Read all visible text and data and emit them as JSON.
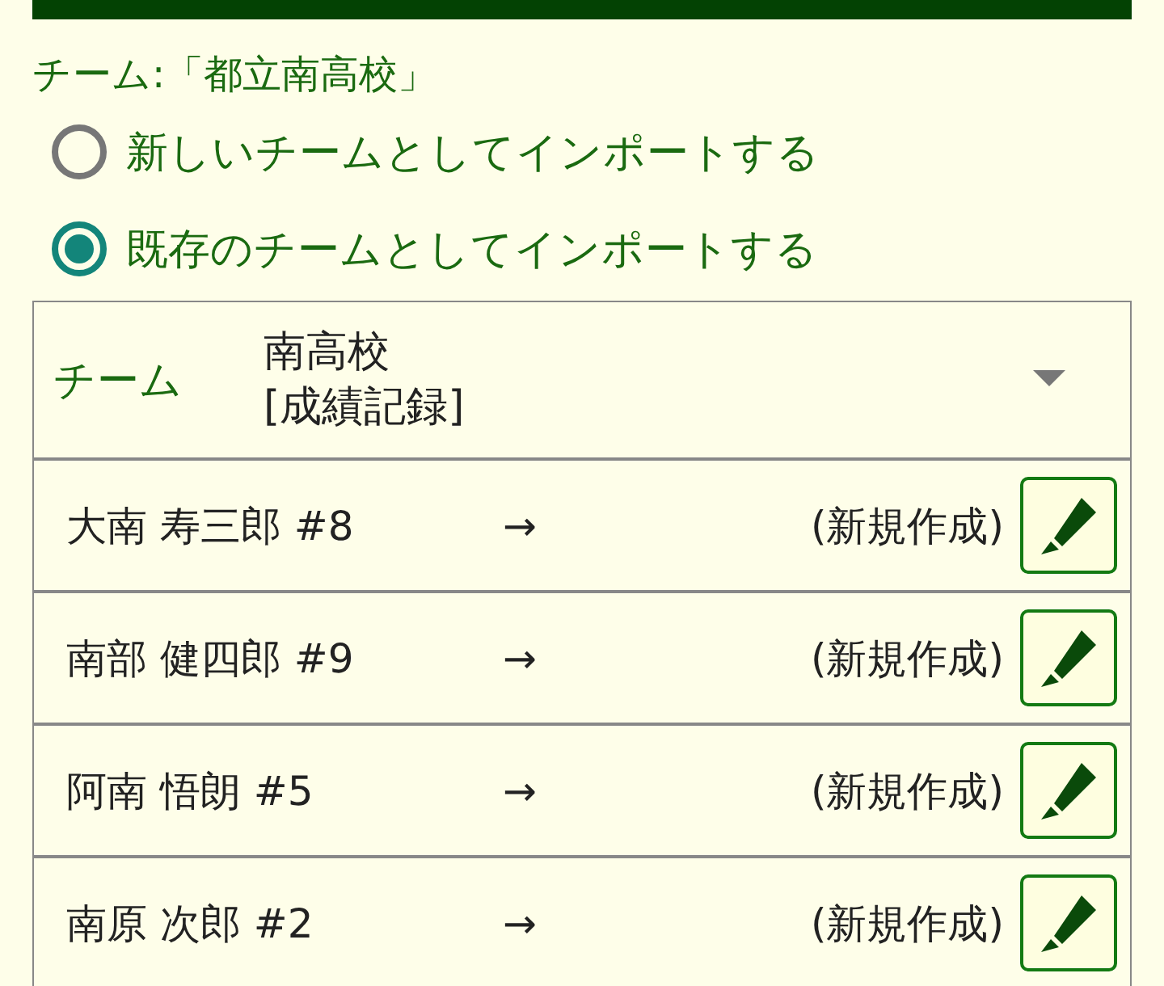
{
  "team_heading": "チーム:「都立南高校」",
  "import_options": [
    {
      "label": "新しいチームとしてインポートする",
      "selected": false
    },
    {
      "label": "既存のチームとしてインポートする",
      "selected": true
    }
  ],
  "team_select": {
    "label": "チーム",
    "value_line_1": "南高校",
    "value_line_2": "[成績記録]"
  },
  "players": [
    {
      "name": "大南 寿三郎 #8",
      "arrow": "→",
      "target": "(新規作成)"
    },
    {
      "name": "南部 健四郎 #9",
      "arrow": "→",
      "target": "(新規作成)"
    },
    {
      "name": "阿南 悟朗 #5",
      "arrow": "→",
      "target": "(新規作成)"
    },
    {
      "name": "南原 次郎 #2",
      "arrow": "→",
      "target": "(新規作成)"
    }
  ]
}
